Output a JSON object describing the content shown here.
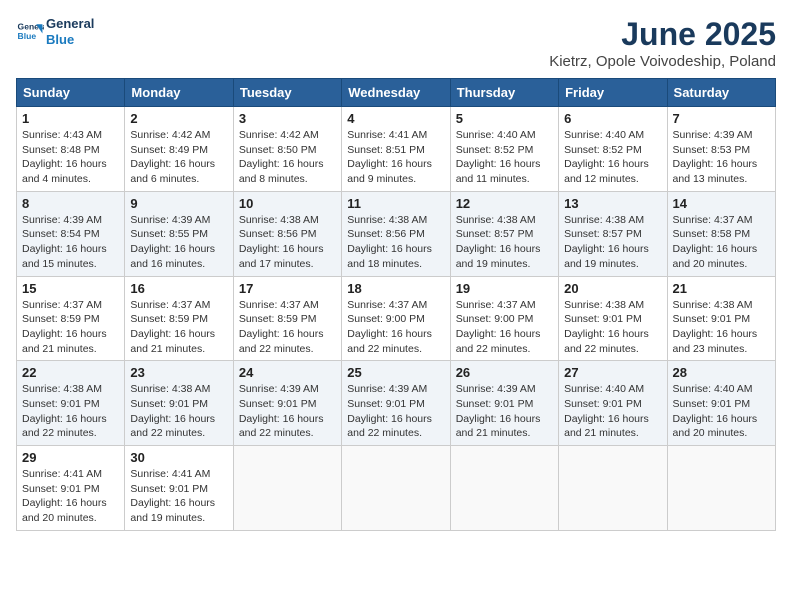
{
  "header": {
    "logo_line1": "General",
    "logo_line2": "Blue",
    "title": "June 2025",
    "subtitle": "Kietrz, Opole Voivodeship, Poland"
  },
  "calendar": {
    "headers": [
      "Sunday",
      "Monday",
      "Tuesday",
      "Wednesday",
      "Thursday",
      "Friday",
      "Saturday"
    ],
    "weeks": [
      [
        {
          "day": "1",
          "sunrise": "Sunrise: 4:43 AM",
          "sunset": "Sunset: 8:48 PM",
          "daylight": "Daylight: 16 hours and 4 minutes."
        },
        {
          "day": "2",
          "sunrise": "Sunrise: 4:42 AM",
          "sunset": "Sunset: 8:49 PM",
          "daylight": "Daylight: 16 hours and 6 minutes."
        },
        {
          "day": "3",
          "sunrise": "Sunrise: 4:42 AM",
          "sunset": "Sunset: 8:50 PM",
          "daylight": "Daylight: 16 hours and 8 minutes."
        },
        {
          "day": "4",
          "sunrise": "Sunrise: 4:41 AM",
          "sunset": "Sunset: 8:51 PM",
          "daylight": "Daylight: 16 hours and 9 minutes."
        },
        {
          "day": "5",
          "sunrise": "Sunrise: 4:40 AM",
          "sunset": "Sunset: 8:52 PM",
          "daylight": "Daylight: 16 hours and 11 minutes."
        },
        {
          "day": "6",
          "sunrise": "Sunrise: 4:40 AM",
          "sunset": "Sunset: 8:52 PM",
          "daylight": "Daylight: 16 hours and 12 minutes."
        },
        {
          "day": "7",
          "sunrise": "Sunrise: 4:39 AM",
          "sunset": "Sunset: 8:53 PM",
          "daylight": "Daylight: 16 hours and 13 minutes."
        }
      ],
      [
        {
          "day": "8",
          "sunrise": "Sunrise: 4:39 AM",
          "sunset": "Sunset: 8:54 PM",
          "daylight": "Daylight: 16 hours and 15 minutes."
        },
        {
          "day": "9",
          "sunrise": "Sunrise: 4:39 AM",
          "sunset": "Sunset: 8:55 PM",
          "daylight": "Daylight: 16 hours and 16 minutes."
        },
        {
          "day": "10",
          "sunrise": "Sunrise: 4:38 AM",
          "sunset": "Sunset: 8:56 PM",
          "daylight": "Daylight: 16 hours and 17 minutes."
        },
        {
          "day": "11",
          "sunrise": "Sunrise: 4:38 AM",
          "sunset": "Sunset: 8:56 PM",
          "daylight": "Daylight: 16 hours and 18 minutes."
        },
        {
          "day": "12",
          "sunrise": "Sunrise: 4:38 AM",
          "sunset": "Sunset: 8:57 PM",
          "daylight": "Daylight: 16 hours and 19 minutes."
        },
        {
          "day": "13",
          "sunrise": "Sunrise: 4:38 AM",
          "sunset": "Sunset: 8:57 PM",
          "daylight": "Daylight: 16 hours and 19 minutes."
        },
        {
          "day": "14",
          "sunrise": "Sunrise: 4:37 AM",
          "sunset": "Sunset: 8:58 PM",
          "daylight": "Daylight: 16 hours and 20 minutes."
        }
      ],
      [
        {
          "day": "15",
          "sunrise": "Sunrise: 4:37 AM",
          "sunset": "Sunset: 8:59 PM",
          "daylight": "Daylight: 16 hours and 21 minutes."
        },
        {
          "day": "16",
          "sunrise": "Sunrise: 4:37 AM",
          "sunset": "Sunset: 8:59 PM",
          "daylight": "Daylight: 16 hours and 21 minutes."
        },
        {
          "day": "17",
          "sunrise": "Sunrise: 4:37 AM",
          "sunset": "Sunset: 8:59 PM",
          "daylight": "Daylight: 16 hours and 22 minutes."
        },
        {
          "day": "18",
          "sunrise": "Sunrise: 4:37 AM",
          "sunset": "Sunset: 9:00 PM",
          "daylight": "Daylight: 16 hours and 22 minutes."
        },
        {
          "day": "19",
          "sunrise": "Sunrise: 4:37 AM",
          "sunset": "Sunset: 9:00 PM",
          "daylight": "Daylight: 16 hours and 22 minutes."
        },
        {
          "day": "20",
          "sunrise": "Sunrise: 4:38 AM",
          "sunset": "Sunset: 9:01 PM",
          "daylight": "Daylight: 16 hours and 22 minutes."
        },
        {
          "day": "21",
          "sunrise": "Sunrise: 4:38 AM",
          "sunset": "Sunset: 9:01 PM",
          "daylight": "Daylight: 16 hours and 23 minutes."
        }
      ],
      [
        {
          "day": "22",
          "sunrise": "Sunrise: 4:38 AM",
          "sunset": "Sunset: 9:01 PM",
          "daylight": "Daylight: 16 hours and 22 minutes."
        },
        {
          "day": "23",
          "sunrise": "Sunrise: 4:38 AM",
          "sunset": "Sunset: 9:01 PM",
          "daylight": "Daylight: 16 hours and 22 minutes."
        },
        {
          "day": "24",
          "sunrise": "Sunrise: 4:39 AM",
          "sunset": "Sunset: 9:01 PM",
          "daylight": "Daylight: 16 hours and 22 minutes."
        },
        {
          "day": "25",
          "sunrise": "Sunrise: 4:39 AM",
          "sunset": "Sunset: 9:01 PM",
          "daylight": "Daylight: 16 hours and 22 minutes."
        },
        {
          "day": "26",
          "sunrise": "Sunrise: 4:39 AM",
          "sunset": "Sunset: 9:01 PM",
          "daylight": "Daylight: 16 hours and 21 minutes."
        },
        {
          "day": "27",
          "sunrise": "Sunrise: 4:40 AM",
          "sunset": "Sunset: 9:01 PM",
          "daylight": "Daylight: 16 hours and 21 minutes."
        },
        {
          "day": "28",
          "sunrise": "Sunrise: 4:40 AM",
          "sunset": "Sunset: 9:01 PM",
          "daylight": "Daylight: 16 hours and 20 minutes."
        }
      ],
      [
        {
          "day": "29",
          "sunrise": "Sunrise: 4:41 AM",
          "sunset": "Sunset: 9:01 PM",
          "daylight": "Daylight: 16 hours and 20 minutes."
        },
        {
          "day": "30",
          "sunrise": "Sunrise: 4:41 AM",
          "sunset": "Sunset: 9:01 PM",
          "daylight": "Daylight: 16 hours and 19 minutes."
        },
        {
          "day": "",
          "sunrise": "",
          "sunset": "",
          "daylight": ""
        },
        {
          "day": "",
          "sunrise": "",
          "sunset": "",
          "daylight": ""
        },
        {
          "day": "",
          "sunrise": "",
          "sunset": "",
          "daylight": ""
        },
        {
          "day": "",
          "sunrise": "",
          "sunset": "",
          "daylight": ""
        },
        {
          "day": "",
          "sunrise": "",
          "sunset": "",
          "daylight": ""
        }
      ]
    ]
  }
}
